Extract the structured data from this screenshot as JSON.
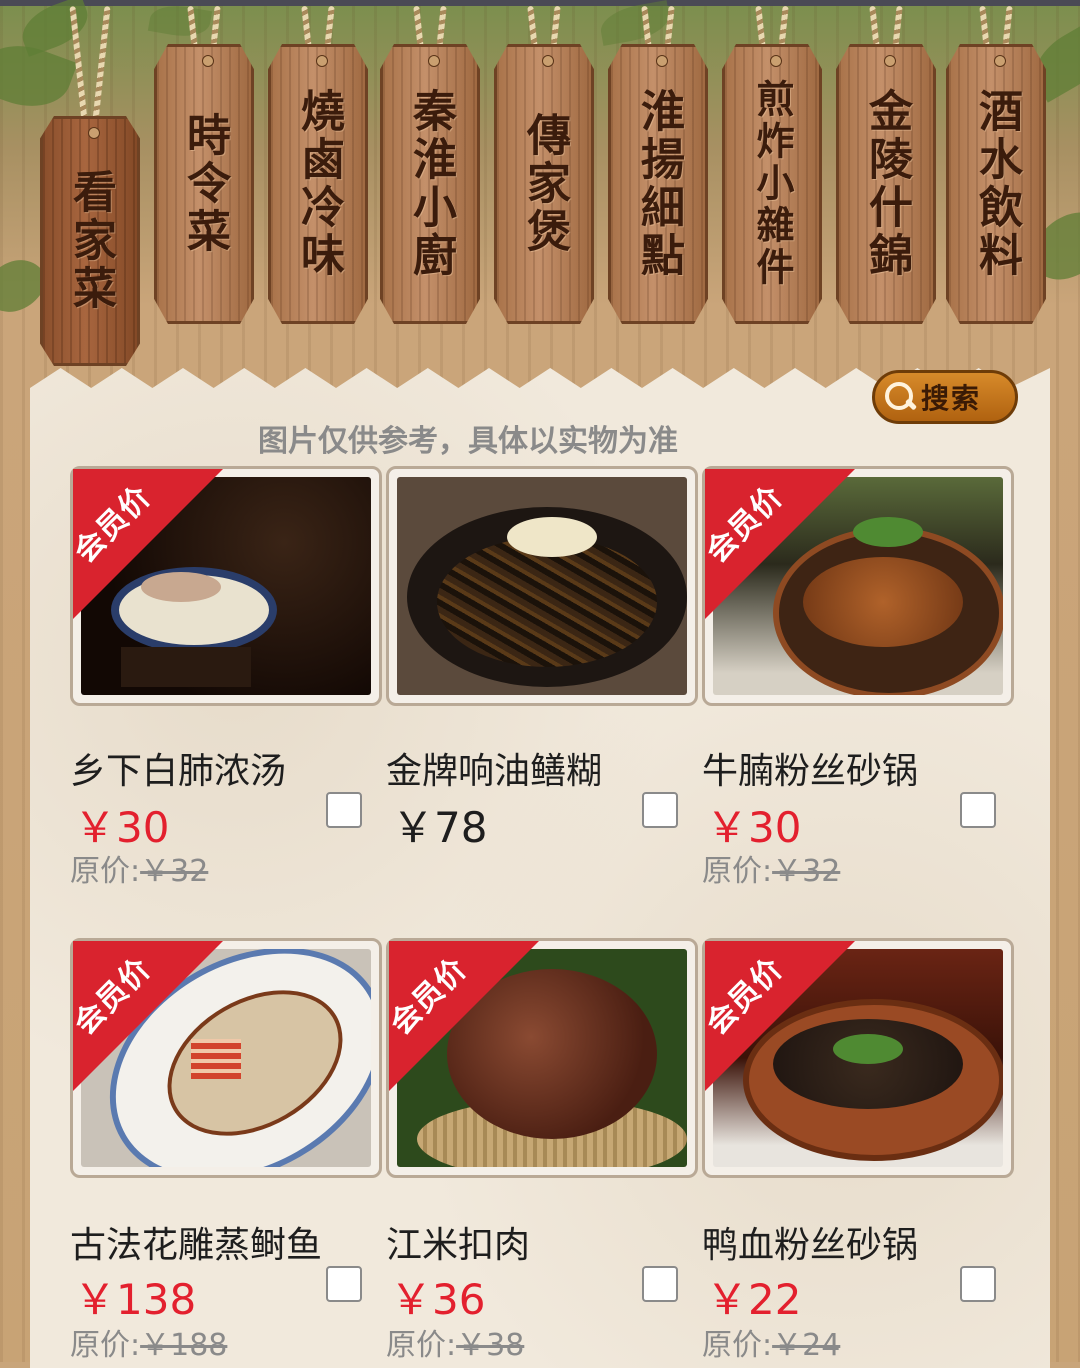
{
  "colors": {
    "member_price": "#e3202e",
    "ribbon": "#d9232e",
    "search_button": "#c47418"
  },
  "categories": [
    {
      "label": "看家菜",
      "active": true
    },
    {
      "label": "時令菜",
      "active": false
    },
    {
      "label": "燒鹵冷味",
      "active": false
    },
    {
      "label": "秦淮小廚",
      "active": false
    },
    {
      "label": "傳家煲",
      "active": false
    },
    {
      "label": "淮揚細點",
      "active": false
    },
    {
      "label": "煎炸小雜件",
      "active": false
    },
    {
      "label": "金陵什錦",
      "active": false
    },
    {
      "label": "酒水飲料",
      "active": false
    }
  ],
  "search": {
    "label": "搜索",
    "icon": "search-icon"
  },
  "notice": "图片仅供参考，具体以实物为准",
  "ribbon_text": "会员价",
  "orig_prefix": "原价:",
  "dishes": [
    {
      "name": "乡下白肺浓汤",
      "price": "￥30",
      "orig": "￥32",
      "member": true
    },
    {
      "name": "金牌响油鳝糊",
      "price": "￥78",
      "orig": "",
      "member": false
    },
    {
      "name": "牛腩粉丝砂锅",
      "price": "￥30",
      "orig": "￥32",
      "member": true
    },
    {
      "name": "古法花雕蒸鲥鱼",
      "price": "￥138",
      "orig": "￥188",
      "member": true
    },
    {
      "name": "江米扣肉",
      "price": "￥36",
      "orig": "￥38",
      "member": true
    },
    {
      "name": "鸭血粉丝砂锅",
      "price": "￥22",
      "orig": "￥24",
      "member": true
    }
  ]
}
